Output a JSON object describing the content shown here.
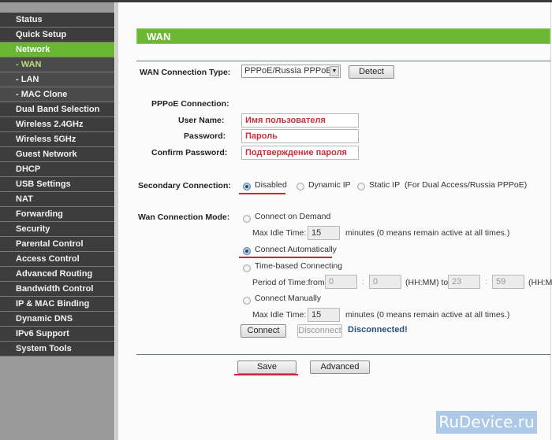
{
  "sidebar": {
    "items": [
      {
        "label": "Status"
      },
      {
        "label": "Quick Setup"
      },
      {
        "label": "Network"
      },
      {
        "label": "- WAN"
      },
      {
        "label": "- LAN"
      },
      {
        "label": "- MAC Clone"
      },
      {
        "label": "Dual Band Selection"
      },
      {
        "label": "Wireless 2.4GHz"
      },
      {
        "label": "Wireless 5GHz"
      },
      {
        "label": "Guest Network"
      },
      {
        "label": "DHCP"
      },
      {
        "label": "USB Settings"
      },
      {
        "label": "NAT"
      },
      {
        "label": "Forwarding"
      },
      {
        "label": "Security"
      },
      {
        "label": "Parental Control"
      },
      {
        "label": "Access Control"
      },
      {
        "label": "Advanced Routing"
      },
      {
        "label": "Bandwidth Control"
      },
      {
        "label": "IP & MAC Binding"
      },
      {
        "label": "Dynamic DNS"
      },
      {
        "label": "IPv6 Support"
      },
      {
        "label": "System Tools"
      }
    ],
    "active_color": "#68b631"
  },
  "page": {
    "title": "WAN",
    "wan_type_label": "WAN Connection Type:",
    "wan_type_value": "PPPoE/Russia PPPoE",
    "detect_label": "Detect",
    "pppoe_label": "PPPoE Connection:",
    "username_label": "User Name:",
    "username_value": "Имя пользователя",
    "password_label": "Password:",
    "password_value": "Пароль",
    "confirm_label": "Confirm Password:",
    "confirm_value": "Подтверждение пароля",
    "secondary_label": "Secondary Connection:",
    "secondary_options": [
      "Disabled",
      "Dynamic IP",
      "Static IP"
    ],
    "secondary_selected": "Disabled",
    "secondary_note": "(For Dual Access/Russia PPPoE)",
    "mode_label": "Wan Connection Mode:",
    "mode_options": {
      "on_demand": "Connect on Demand",
      "auto": "Connect Automatically",
      "time_based": "Time-based Connecting",
      "manual": "Connect Manually"
    },
    "mode_selected": "Connect Automatically",
    "max_idle_label": "Max Idle Time:",
    "max_idle_value_1": "15",
    "max_idle_value_2": "15",
    "minutes_note": "minutes (0 means remain active at all times.)",
    "period_label": "Period of Time:from",
    "from_hh": "0",
    "from_mm": "0",
    "colon": ":",
    "hhmm_to": "(HH:MM) to",
    "to_hh": "23",
    "to_mm": "59",
    "hhmm": "(HH:MM)",
    "connect_label": "Connect",
    "disconnect_label": "Disconnect",
    "status": "Disconnected!",
    "save_label": "Save",
    "advanced_label": "Advanced",
    "highlight_color": "#c8283a"
  },
  "watermark": "RuDevice.ru"
}
